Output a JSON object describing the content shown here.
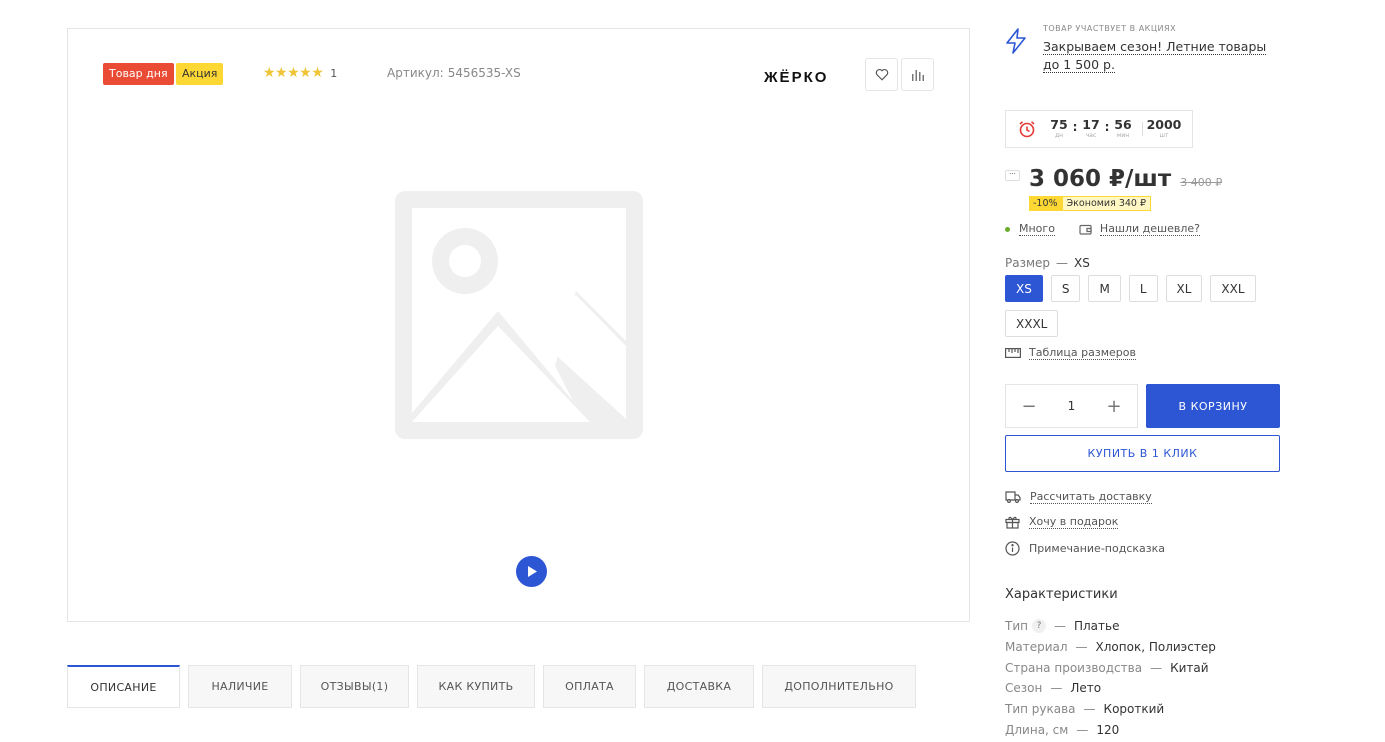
{
  "gallery": {
    "badges": {
      "day": "Товар дня",
      "sale": "Акция"
    },
    "rating": {
      "stars": "★★★★★",
      "count": "1"
    },
    "article": {
      "label": "Артикул:",
      "value": "5456535-XS"
    },
    "brand": "ЖЁРКО",
    "icons": {
      "favorite": "heart-icon",
      "compare": "bar-chart-icon",
      "placeholder": "image-placeholder-icon",
      "video": "play-icon"
    }
  },
  "tabs": [
    {
      "label": "ОПИСАНИЕ",
      "active": true
    },
    {
      "label": "НАЛИЧИЕ"
    },
    {
      "label": "ОТЗЫВЫ(1)"
    },
    {
      "label": "КАК КУПИТЬ"
    },
    {
      "label": "ОПЛАТА"
    },
    {
      "label": "ДОСТАВКА"
    },
    {
      "label": "ДОПОЛНИТЕЛЬНО"
    }
  ],
  "promo": {
    "label": "ТОВАР УЧАСТВУЕТ В АКЦИЯХ",
    "title": "Закрываем сезон! Летние товары до 1 500 р."
  },
  "timer": {
    "days": {
      "value": "75",
      "label": "дн"
    },
    "hours": {
      "value": "17",
      "label": "час"
    },
    "minutes": {
      "value": "56",
      "label": "мин"
    },
    "stock": {
      "value": "2000",
      "label": "шт"
    },
    "colon": ":"
  },
  "price": {
    "toggle": "···",
    "current": "3 060 ₽/шт",
    "old": "3 400 ₽",
    "discount_pct": "-10%",
    "savings": "Экономия 340 ₽"
  },
  "availability": {
    "status": "Много",
    "cheaper": "Нашли дешевле?"
  },
  "size": {
    "label": "Размер",
    "dash": "—",
    "selected": "XS",
    "options": [
      "XS",
      "S",
      "M",
      "L",
      "XL",
      "XXL",
      "XXXL"
    ],
    "table_link": "Таблица размеров"
  },
  "cart": {
    "minus": "−",
    "plus": "+",
    "quantity": "1",
    "add_label": "В КОРЗИНУ",
    "one_click_label": "КУПИТЬ В 1 КЛИК"
  },
  "actions": {
    "delivery": "Рассчитать доставку",
    "gift": "Хочу в подарок",
    "hint": "Примечание-подсказка"
  },
  "characteristics": {
    "title": "Характеристики",
    "help": "?",
    "dash": "—",
    "items": [
      {
        "name": "Тип",
        "value": "Платье",
        "help": true
      },
      {
        "name": "Материал",
        "value": "Хлопок, Полиэстер"
      },
      {
        "name": "Страна производства",
        "value": "Китай"
      },
      {
        "name": "Сезон",
        "value": "Лето"
      },
      {
        "name": "Тип рукава",
        "value": "Короткий"
      },
      {
        "name": "Длина, см",
        "value": "120"
      }
    ]
  },
  "colors": {
    "accent": "#2c56d4",
    "badge_red": "#e94b35",
    "badge_yellow": "#fdd835",
    "star": "#f0c437",
    "in_stock": "#6aab2e",
    "timer_icon": "#e53935"
  }
}
